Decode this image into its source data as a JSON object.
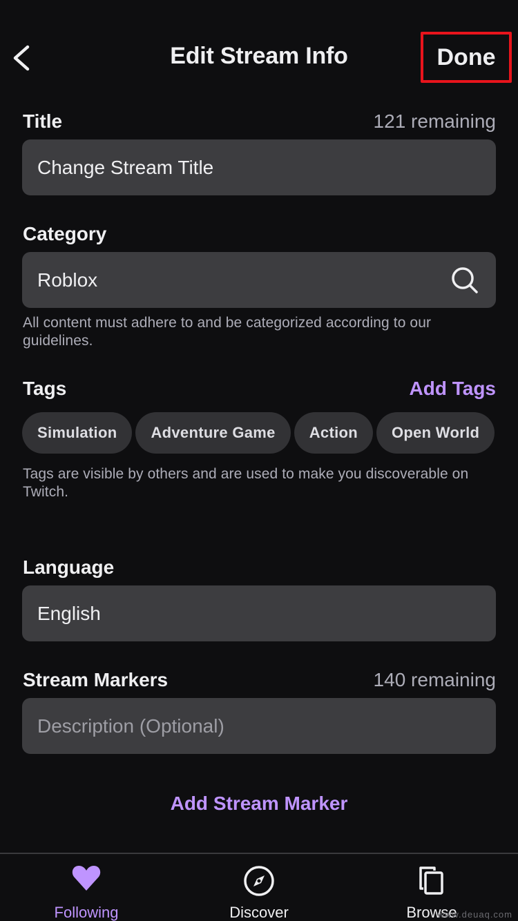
{
  "header": {
    "title": "Edit Stream Info",
    "back_icon": "chevron-left-icon",
    "done_label": "Done"
  },
  "title_section": {
    "label": "Title",
    "remaining": "121 remaining",
    "value": "Change Stream Title"
  },
  "category_section": {
    "label": "Category",
    "value": "Roblox",
    "icon": "search-icon",
    "helper": "All content must adhere to and be categorized according to our guidelines."
  },
  "tags_section": {
    "label": "Tags",
    "add_label": "Add Tags",
    "tags": [
      {
        "label": "Simulation"
      },
      {
        "label": "Adventure Game"
      },
      {
        "label": "Action"
      },
      {
        "label": "Open World"
      }
    ],
    "helper": "Tags are visible by others and are used to make you discoverable on Twitch."
  },
  "language_section": {
    "label": "Language",
    "value": "English"
  },
  "markers_section": {
    "label": "Stream Markers",
    "remaining": "140 remaining",
    "placeholder": "Description (Optional)",
    "add_label": "Add Stream Marker"
  },
  "tabbar": {
    "items": [
      {
        "label": "Following",
        "icon": "heart-icon",
        "active": true
      },
      {
        "label": "Discover",
        "icon": "compass-icon",
        "active": false
      },
      {
        "label": "Browse",
        "icon": "browse-icon",
        "active": false
      }
    ]
  },
  "colors": {
    "background": "#0e0e10",
    "field": "#3d3d40",
    "accent": "#bf94ff",
    "highlight_box": "#e8141c"
  },
  "watermark": "www.deuaq.com"
}
